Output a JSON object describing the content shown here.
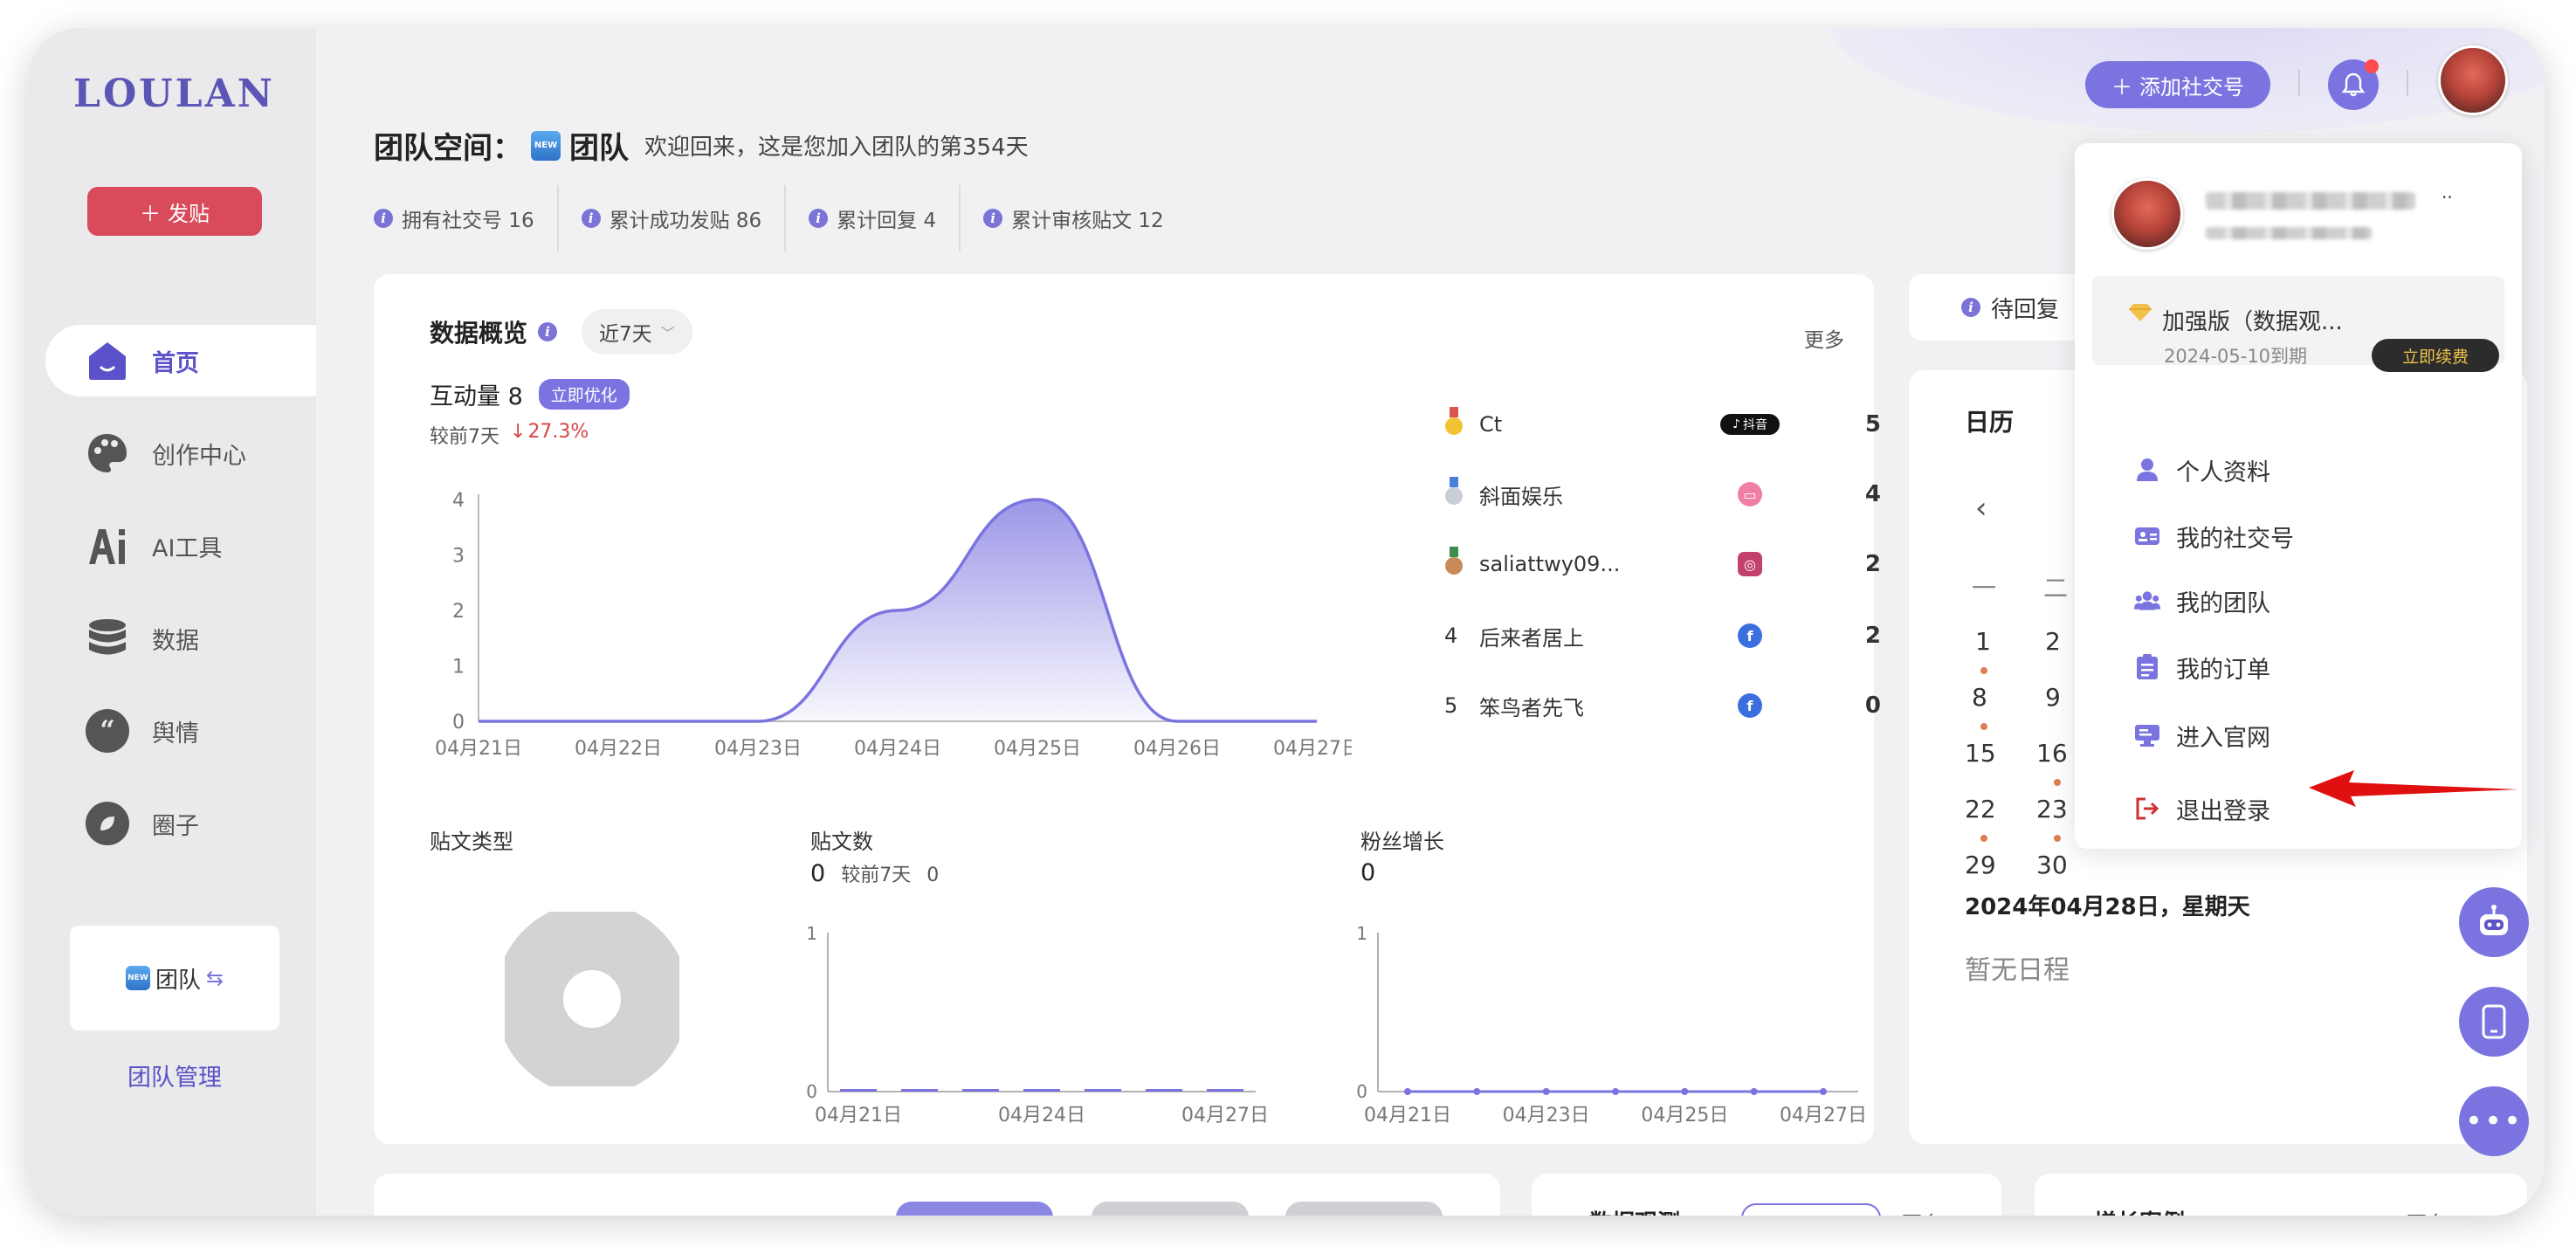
{
  "brand": {
    "logo": "LOULAN"
  },
  "sidebar": {
    "post_button": "发贴",
    "items": [
      {
        "label": "首页",
        "icon": "home-icon"
      },
      {
        "label": "创作中心",
        "icon": "palette-icon"
      },
      {
        "label": "AI工具",
        "icon": "ai-icon"
      },
      {
        "label": "数据",
        "icon": "database-icon"
      },
      {
        "label": "舆情",
        "icon": "quote-icon"
      },
      {
        "label": "圈子",
        "icon": "leaf-icon"
      }
    ],
    "team_name": "团队",
    "team_mgmt": "团队管理"
  },
  "header": {
    "title_prefix": "团队空间：",
    "title_team": "团队",
    "welcome": "欢迎回来，这是您加入团队的第354天",
    "stats": [
      "拥有社交号 16",
      "累计成功发贴 86",
      "累计回复 4",
      "累计审核贴文 12"
    ],
    "add_button": "添加社交号"
  },
  "overview": {
    "title": "数据概览",
    "period": "近7天",
    "more": "更多",
    "interaction_label": "互动量 8",
    "optimize_badge": "立即优化",
    "compare_label": "较前7天",
    "compare_value": "27.3%",
    "ranking": [
      {
        "no": "",
        "name": "Ct",
        "platform": "抖音",
        "value": "5"
      },
      {
        "no": "",
        "name": "斜面娱乐",
        "platform": "bilibili",
        "value": "4"
      },
      {
        "no": "",
        "name": "saliattwy09...",
        "platform": "instagram",
        "value": "2"
      },
      {
        "no": "4",
        "name": "后来者居上",
        "platform": "facebook",
        "value": "2"
      },
      {
        "no": "5",
        "name": "笨鸟者先飞",
        "platform": "facebook",
        "value": "0"
      }
    ],
    "post_type_label": "贴文类型",
    "post_count_label": "贴文数",
    "post_count_value": "0",
    "post_compare_label": "较前7天",
    "post_compare_value": "0",
    "fans_label": "粉丝增长",
    "fans_value": "0"
  },
  "chart_data": [
    {
      "type": "area",
      "x": [
        "04月21日",
        "04月22日",
        "04月23日",
        "04月24日",
        "04月25日",
        "04月26日",
        "04月27日"
      ],
      "values": [
        0,
        0,
        0,
        2,
        4,
        0,
        0
      ],
      "yticks": [
        "0",
        "1",
        "2",
        "3",
        "4"
      ],
      "ylim": [
        0,
        4
      ],
      "color": "#7b74e0"
    },
    {
      "type": "pie",
      "values": [
        1
      ],
      "color": "#d3d3d3"
    },
    {
      "type": "bar",
      "x": [
        "04月21日",
        "04月22日",
        "04月23日",
        "04月24日",
        "04月25日",
        "04月26日",
        "04月27日"
      ],
      "xticks": [
        "04月21日",
        "04月24日",
        "04月27日"
      ],
      "values": [
        0,
        0,
        0,
        0,
        0,
        0,
        0
      ],
      "yticks": [
        "0",
        "1"
      ],
      "ylim": [
        0,
        1
      ]
    },
    {
      "type": "line",
      "x": [
        "04月21日",
        "04月22日",
        "04月23日",
        "04月24日",
        "04月25日",
        "04月26日",
        "04月27日"
      ],
      "xticks": [
        "04月21日",
        "04月23日",
        "04月25日",
        "04月27日"
      ],
      "values": [
        0,
        0,
        0,
        0,
        0,
        0,
        0
      ],
      "yticks": [
        "0",
        "1"
      ],
      "ylim": [
        0,
        1
      ]
    }
  ],
  "pending": {
    "label": "待回复"
  },
  "calendar": {
    "title": "日历",
    "weekdays": [
      "一",
      "二"
    ],
    "days_col1": [
      "1",
      "8",
      "15",
      "22",
      "29"
    ],
    "days_col2": [
      "2",
      "9",
      "16",
      "23",
      "30"
    ],
    "selected_date": "2024年04月28日，星期天",
    "empty": "暂无日程"
  },
  "dropdown": {
    "plan_name": "加强版（数据观...",
    "plan_expiry": "2024-05-10到期",
    "renew_button": "立即续费",
    "items": [
      "个人资料",
      "我的社交号",
      "我的团队",
      "我的订单",
      "进入官网",
      "退出登录"
    ]
  },
  "bottom": {
    "label1": "数据观测",
    "label2": "增长案例",
    "more": "更多"
  },
  "colors": {
    "accent": "#7b74e0",
    "danger": "#d94a5a",
    "arrow": "#e01010"
  }
}
